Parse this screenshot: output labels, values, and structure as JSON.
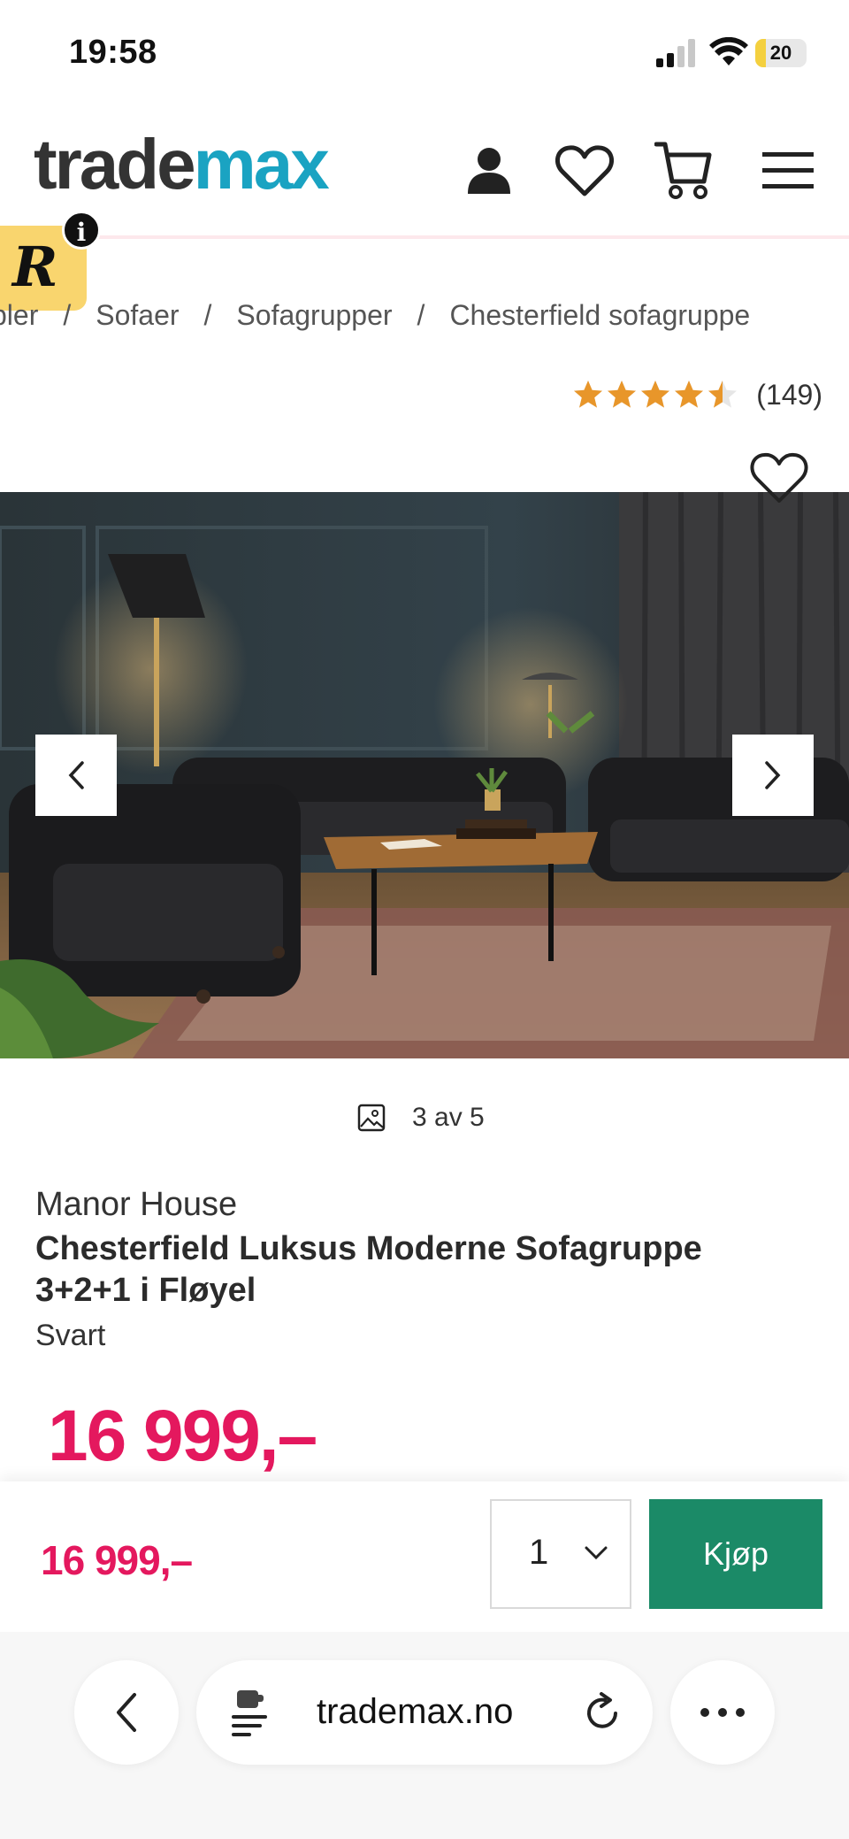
{
  "status": {
    "time": "19:58",
    "battery": "20",
    "battery_level": 0.2
  },
  "header": {
    "logo_part1": "trade",
    "logo_part2": "max",
    "icons": [
      "account-icon",
      "heart-icon",
      "cart-icon",
      "menu-icon"
    ]
  },
  "breadcrumb": {
    "items": [
      "bler",
      "Sofaer",
      "Sofagrupper",
      "Chesterfield sofagruppe"
    ],
    "separator": "/"
  },
  "rating": {
    "stars": 4.5,
    "count": "(149)"
  },
  "gallery": {
    "counter": "3 av 5"
  },
  "product": {
    "brand": "Manor House",
    "title": "Chesterfield Luksus Moderne Sofagruppe 3+2+1 i Fløyel",
    "variant": "Svart",
    "price": "16 999,–"
  },
  "buy_bar": {
    "price": "16 999,–",
    "quantity": "1",
    "buy_label": "Kjøp"
  },
  "browser": {
    "url": "trademax.no"
  },
  "colors": {
    "brand_teal": "#1aa3c2",
    "price_pink": "#e4185e",
    "buy_green": "#1b8a67",
    "star_orange": "#e8962a"
  }
}
